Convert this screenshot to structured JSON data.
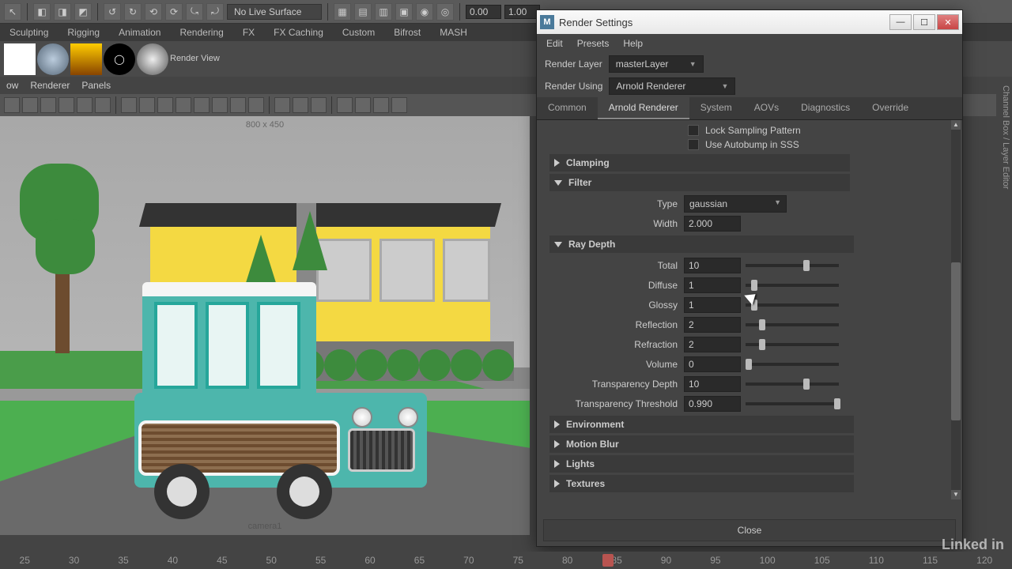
{
  "toolbar": {
    "surface": "No Live Surface",
    "timeA": "0.00",
    "timeB": "1.00"
  },
  "shelfTabs": [
    "Sculpting",
    "Rigging",
    "Animation",
    "Rendering",
    "FX",
    "FX Caching",
    "Custom",
    "Bifrost",
    "MASH"
  ],
  "renderView": "Render View",
  "panelMenus": [
    "ow",
    "Renderer",
    "Panels"
  ],
  "viewport": {
    "dims": "800 x 450",
    "camera": "camera1"
  },
  "dialog": {
    "title": "Render Settings",
    "menus": [
      "Edit",
      "Presets",
      "Help"
    ],
    "renderLayerLabel": "Render Layer",
    "renderLayer": "masterLayer",
    "renderUsingLabel": "Render Using",
    "renderUsing": "Arnold Renderer",
    "tabs": [
      "Common",
      "Arnold Renderer",
      "System",
      "AOVs",
      "Diagnostics",
      "Override"
    ],
    "activeTab": 1,
    "lockSampling": "Lock Sampling Pattern",
    "autobump": "Use Autobump in SSS",
    "sections": {
      "clamping": "Clamping",
      "filter": "Filter",
      "rayDepth": "Ray Depth",
      "environment": "Environment",
      "motionBlur": "Motion Blur",
      "lights": "Lights",
      "textures": "Textures"
    },
    "filter": {
      "typeLabel": "Type",
      "type": "gaussian",
      "widthLabel": "Width",
      "width": "2.000"
    },
    "rayDepth": {
      "totalLabel": "Total",
      "total": "10",
      "diffuseLabel": "Diffuse",
      "diffuse": "1",
      "glossyLabel": "Glossy",
      "glossy": "1",
      "reflectionLabel": "Reflection",
      "reflection": "2",
      "refractionLabel": "Refraction",
      "refraction": "2",
      "volumeLabel": "Volume",
      "volume": "0",
      "transDepthLabel": "Transparency Depth",
      "transDepth": "10",
      "transThreshLabel": "Transparency Threshold",
      "transThresh": "0.990"
    },
    "close": "Close"
  },
  "timeline": [
    "25",
    "30",
    "35",
    "40",
    "45",
    "50",
    "55",
    "60",
    "65",
    "70",
    "75",
    "80",
    "85",
    "90",
    "95",
    "100",
    "105",
    "110",
    "115",
    "120"
  ],
  "rightPanels": "Channel Box / Layer Editor",
  "watermark": "Linked in"
}
